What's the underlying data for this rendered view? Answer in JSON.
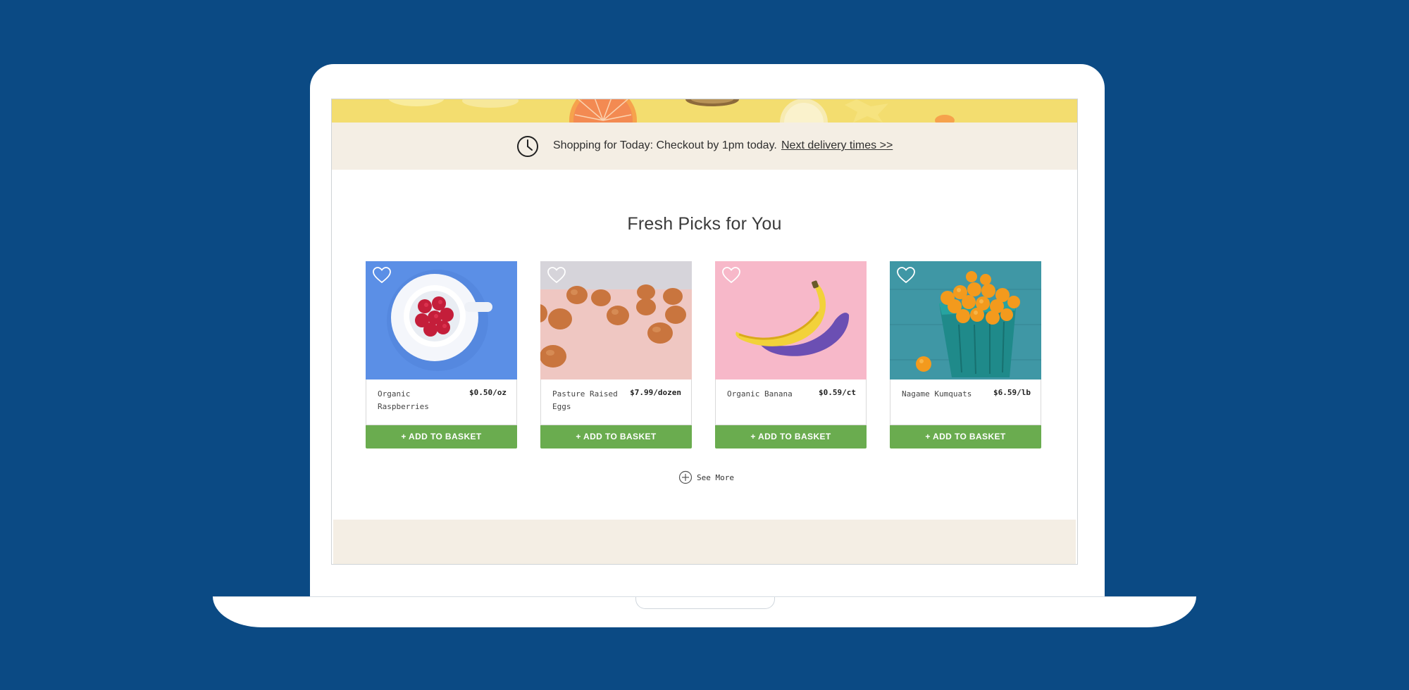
{
  "promo": {
    "text": "Shopping for Today: Checkout by 1pm today.",
    "link": "Next delivery times >>"
  },
  "section": {
    "title": "Fresh Picks for You"
  },
  "products": [
    {
      "name": "Organic Raspberries",
      "price": "$0.50/oz",
      "button": "+ ADD TO BASKET",
      "image": "raspberries-photo",
      "bg": "#5b8fe6"
    },
    {
      "name": "Pasture Raised Eggs",
      "price": "$7.99/dozen",
      "button": "+ ADD TO BASKET",
      "image": "eggs-photo",
      "bg": "#efc7c2"
    },
    {
      "name": "Organic Banana",
      "price": "$0.59/ct",
      "button": "+ ADD TO BASKET",
      "image": "banana-photo",
      "bg": "#f7b8c9"
    },
    {
      "name": "Nagame Kumquats",
      "price": "$6.59/lb",
      "button": "+ ADD TO BASKET",
      "image": "kumquats-photo",
      "bg": "#3f97a5"
    }
  ],
  "see_more": {
    "label": "See More"
  },
  "colors": {
    "background": "#0b4a84",
    "button": "#6aac4f",
    "promo_bar": "#f4eee4"
  },
  "icons": {
    "clock": "clock-icon",
    "heart": "heart-icon",
    "plus": "plus-circle-icon"
  }
}
